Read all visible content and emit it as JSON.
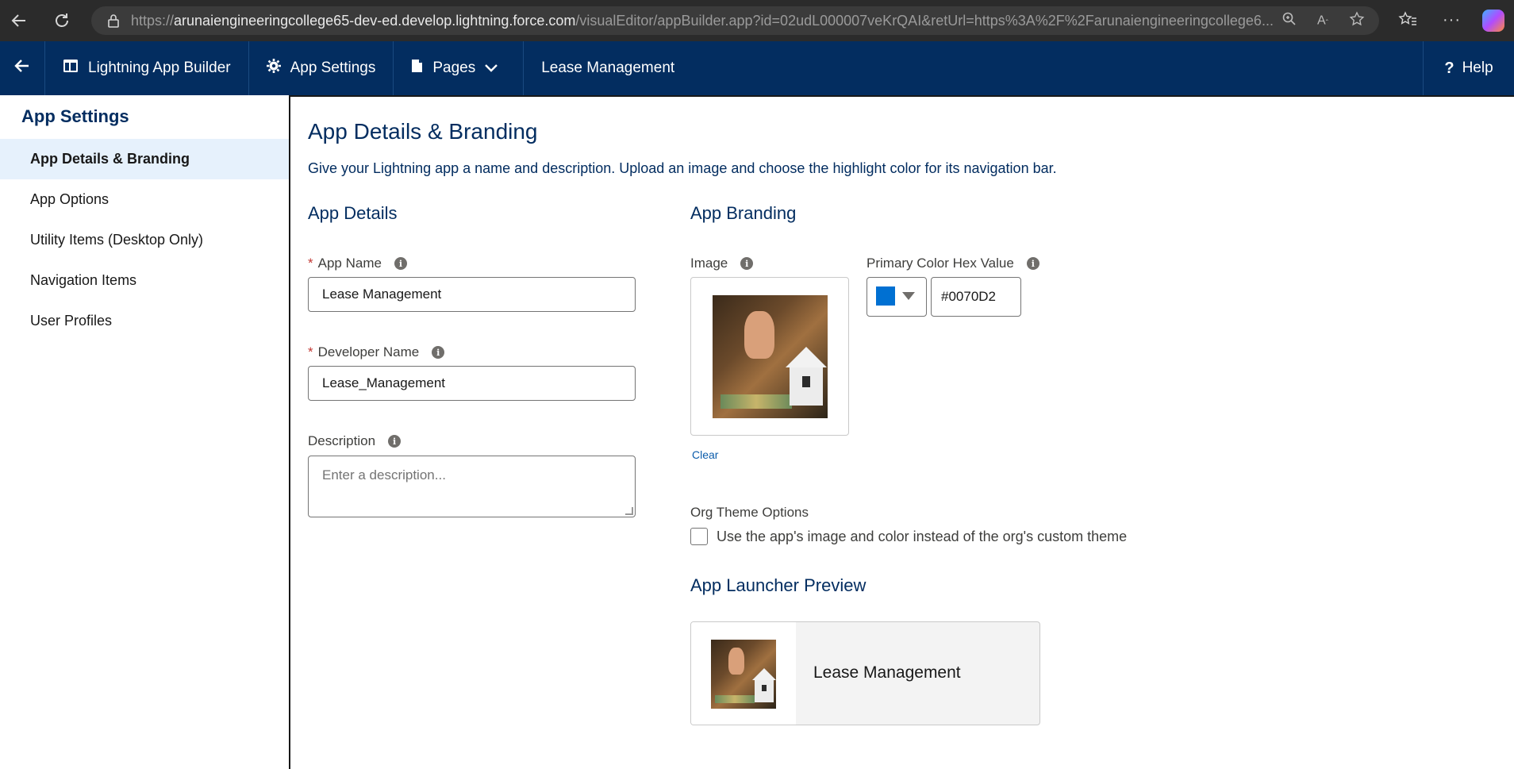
{
  "browser": {
    "url_prefix": "https://",
    "url_host": "arunaiengineeringcollege65-dev-ed.develop.lightning.force.com",
    "url_path": "/visualEditor/appBuilder.app?id=02udL000007veKrQAI&retUrl=https%3A%2F%2Farunaiengineeringcollege6..."
  },
  "header": {
    "builder_label": "Lightning App Builder",
    "settings_label": "App Settings",
    "pages_label": "Pages",
    "app_label": "Lease Management",
    "help_label": "Help"
  },
  "sidebar": {
    "title": "App Settings",
    "items": [
      {
        "label": "App Details & Branding",
        "active": true
      },
      {
        "label": "App Options",
        "active": false
      },
      {
        "label": "Utility Items (Desktop Only)",
        "active": false
      },
      {
        "label": "Navigation Items",
        "active": false
      },
      {
        "label": "User Profiles",
        "active": false
      }
    ]
  },
  "main": {
    "title": "App Details & Branding",
    "description": "Give your Lightning app a name and description. Upload an image and choose the highlight color for its navigation bar.",
    "details": {
      "heading": "App Details",
      "app_name_label": "App Name",
      "app_name_value": "Lease Management",
      "dev_name_label": "Developer Name",
      "dev_name_value": "Lease_Management",
      "desc_label": "Description",
      "desc_placeholder": "Enter a description..."
    },
    "branding": {
      "heading": "App Branding",
      "image_label": "Image",
      "clear_label": "Clear",
      "color_label": "Primary Color Hex Value",
      "color_value": "#0070D2",
      "theme_label": "Org Theme Options",
      "theme_checkbox_label": "Use the app's image and color instead of the org's custom theme",
      "theme_checked": false
    },
    "preview": {
      "heading": "App Launcher Preview",
      "app_name": "Lease Management"
    }
  },
  "colors": {
    "header_bg": "#032d60",
    "brand_primary": "#0070d2",
    "active_item_bg": "#e6f1fc"
  }
}
